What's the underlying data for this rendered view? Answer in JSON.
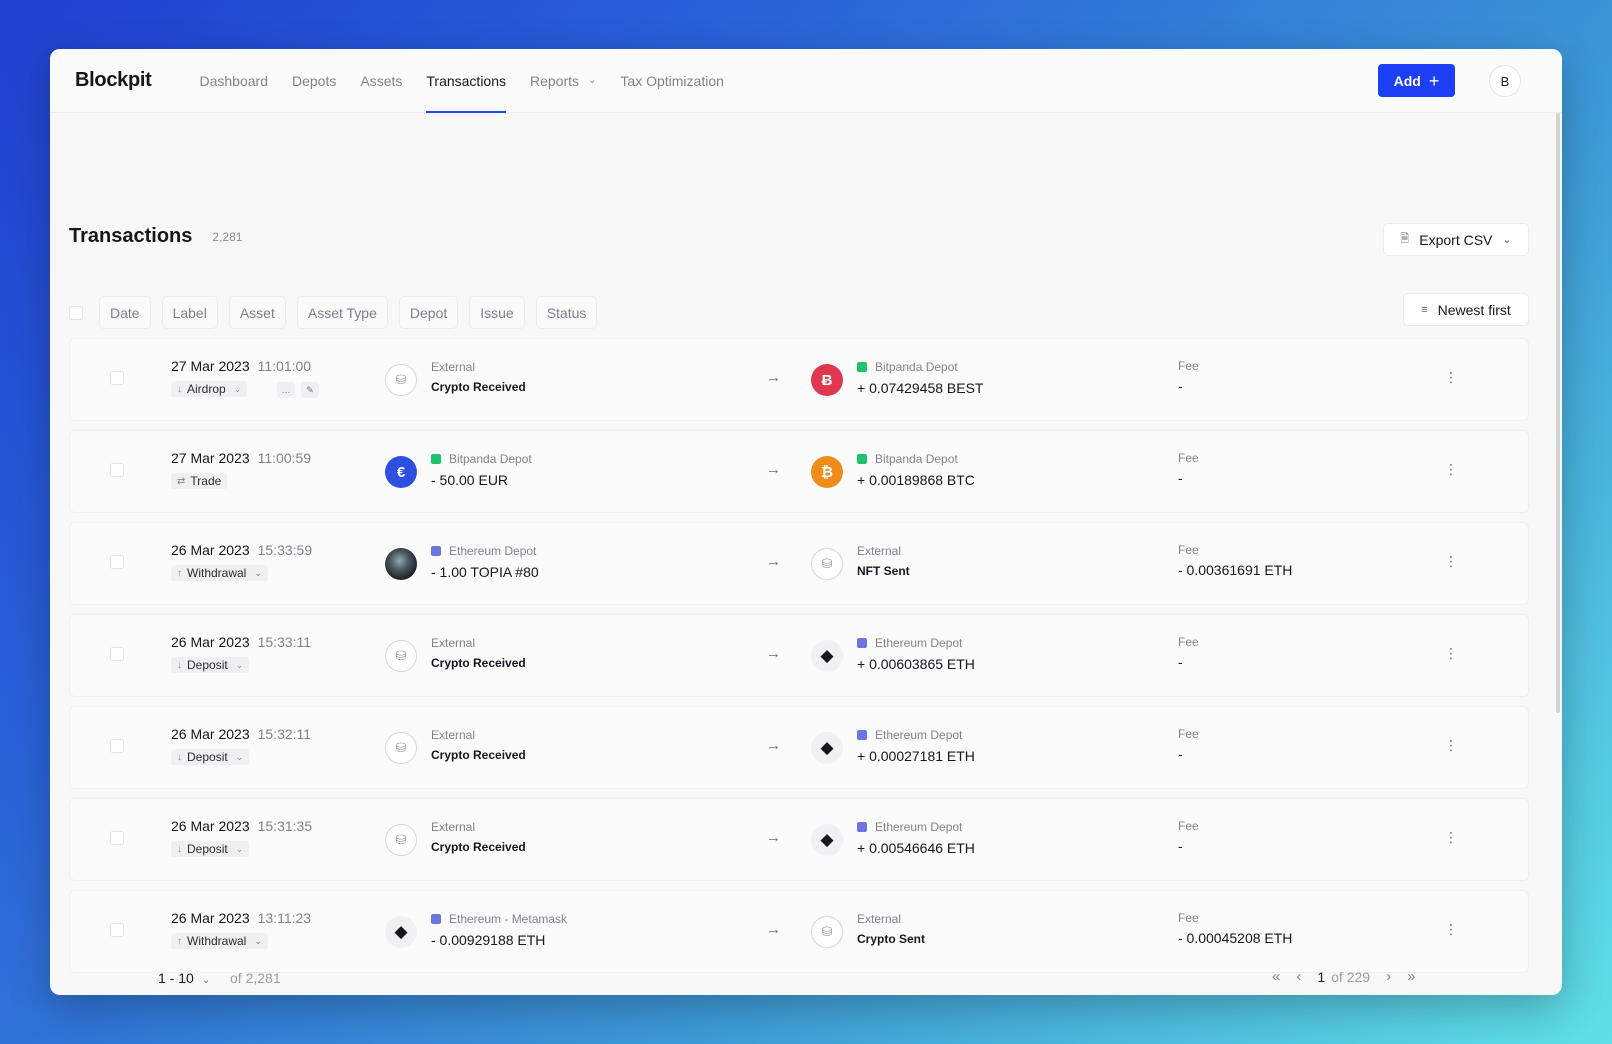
{
  "app": {
    "logo": "Blockpit",
    "nav": [
      {
        "label": "Dashboard",
        "active": false
      },
      {
        "label": "Depots",
        "active": false
      },
      {
        "label": "Assets",
        "active": false
      },
      {
        "label": "Transactions",
        "active": true
      },
      {
        "label": "Reports",
        "active": false,
        "has_dropdown": true
      },
      {
        "label": "Tax Optimization",
        "active": false
      }
    ],
    "add_button": "Add",
    "avatar_initial": "B",
    "accent_color": "#1d3ff5"
  },
  "page": {
    "title": "Transactions",
    "count": "2,281",
    "export_label": "Export CSV",
    "sort_label": "Newest first",
    "filters": [
      "Date",
      "Label",
      "Asset",
      "Asset Type",
      "Depot",
      "Issue",
      "Status"
    ]
  },
  "transactions": [
    {
      "date": "27 Mar 2023",
      "time": "11:01:00",
      "label": "Airdrop",
      "label_icon": "arrow-down-icon",
      "label_dropdown": true,
      "extra_icons": [
        "comment-icon",
        "edit-icon"
      ],
      "from": {
        "coin": "external-db-icon",
        "sub": "External",
        "main": "Crypto Received",
        "main_small": true
      },
      "to": {
        "coin": "best-icon",
        "sub": "Bitpanda Depot",
        "badge": "green",
        "main": "+ 0.07429458 BEST"
      },
      "fee_label": "Fee",
      "fee": "-"
    },
    {
      "date": "27 Mar 2023",
      "time": "11:00:59",
      "label": "Trade",
      "label_icon": "swap-icon",
      "label_dropdown": false,
      "from": {
        "coin": "eur-icon",
        "sub": "Bitpanda Depot",
        "badge": "green",
        "main": "- 50.00 EUR"
      },
      "to": {
        "coin": "btc-icon",
        "sub": "Bitpanda Depot",
        "badge": "green",
        "main": "+ 0.00189868 BTC"
      },
      "fee_label": "Fee",
      "fee": "-"
    },
    {
      "date": "26 Mar 2023",
      "time": "15:33:59",
      "label": "Withdrawal",
      "label_icon": "arrow-up-icon",
      "label_dropdown": true,
      "from": {
        "coin": "nft-icon",
        "sub": "Ethereum Depot",
        "badge": "purple",
        "main": "- 1.00 TOPIA #80"
      },
      "to": {
        "coin": "external-db-icon",
        "sub": "External",
        "main": "NFT Sent",
        "main_small": true
      },
      "fee_label": "Fee",
      "fee": "- 0.00361691 ETH"
    },
    {
      "date": "26 Mar 2023",
      "time": "15:33:11",
      "label": "Deposit",
      "label_icon": "arrow-down-icon",
      "label_dropdown": true,
      "from": {
        "coin": "external-db-icon",
        "sub": "External",
        "main": "Crypto Received",
        "main_small": true
      },
      "to": {
        "coin": "eth-icon",
        "sub": "Ethereum Depot",
        "badge": "purple",
        "main": "+ 0.00603865 ETH"
      },
      "fee_label": "Fee",
      "fee": "-"
    },
    {
      "date": "26 Mar 2023",
      "time": "15:32:11",
      "label": "Deposit",
      "label_icon": "arrow-down-icon",
      "label_dropdown": true,
      "from": {
        "coin": "external-db-icon",
        "sub": "External",
        "main": "Crypto Received",
        "main_small": true
      },
      "to": {
        "coin": "eth-icon",
        "sub": "Ethereum Depot",
        "badge": "purple",
        "main": "+ 0.00027181 ETH"
      },
      "fee_label": "Fee",
      "fee": "-"
    },
    {
      "date": "26 Mar 2023",
      "time": "15:31:35",
      "label": "Deposit",
      "label_icon": "arrow-down-icon",
      "label_dropdown": true,
      "from": {
        "coin": "external-db-icon",
        "sub": "External",
        "main": "Crypto Received",
        "main_small": true
      },
      "to": {
        "coin": "eth-icon",
        "sub": "Ethereum Depot",
        "badge": "purple",
        "main": "+ 0.00546646 ETH"
      },
      "fee_label": "Fee",
      "fee": "-"
    },
    {
      "date": "26 Mar 2023",
      "time": "13:11:23",
      "label": "Withdrawal",
      "label_icon": "arrow-up-icon",
      "label_dropdown": true,
      "from": {
        "coin": "eth-icon",
        "sub": "Ethereum - Metamask",
        "badge": "purple",
        "main": "- 0.00929188 ETH"
      },
      "to": {
        "coin": "external-db-icon",
        "sub": "External",
        "main": "Crypto Sent",
        "main_small": true
      },
      "fee_label": "Fee",
      "fee": "- 0.00045208 ETH"
    }
  ],
  "pagination": {
    "range": "1 - 10",
    "of_total": "of 2,281",
    "current_page": "1",
    "of_pages": "of 229"
  }
}
